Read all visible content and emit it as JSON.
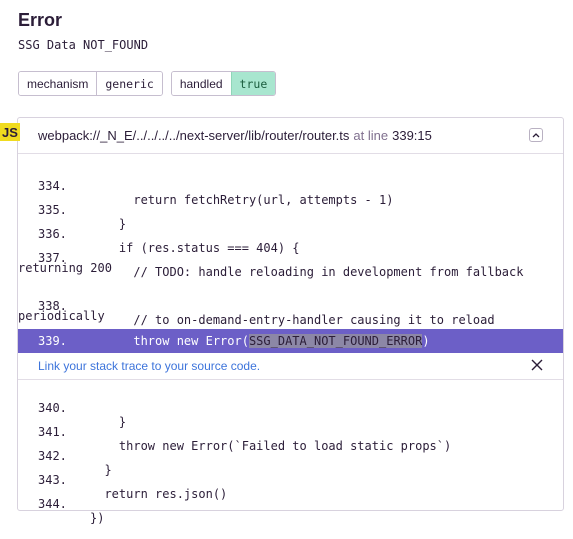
{
  "header": {
    "title": "Error",
    "subtitle": "SSG Data NOT_FOUND"
  },
  "tags": [
    {
      "key": "mechanism",
      "value": "generic"
    },
    {
      "key": "handled",
      "value": "true"
    }
  ],
  "frame": {
    "badge": "JS",
    "path": "webpack://_N_E/../../../../next-server/lib/router/router.ts",
    "at_text": "at line",
    "line_col": "339:15",
    "lines_before": [
      {
        "no": "334.",
        "code": "      return fetchRetry(url, attempts - 1)"
      },
      {
        "no": "335.",
        "code": "    }"
      },
      {
        "no": "336.",
        "code": "    if (res.status === 404) {"
      },
      {
        "no": "337.",
        "code": "      // TODO: handle reloading in development from fallback",
        "wrap": "returning 200"
      },
      {
        "no": "338.",
        "code": "      // to on-demand-entry-handler causing it to reload",
        "wrap": "periodically"
      }
    ],
    "highlight": {
      "no": "339.",
      "code_pre": "      throw new Error(",
      "code_token": "SSG_DATA_NOT_FOUND_ERROR",
      "code_post": ")"
    },
    "suggestion": "Link your stack trace to your source code.",
    "lines_after": [
      {
        "no": "340.",
        "code": "    }"
      },
      {
        "no": "341.",
        "code": "    throw new Error(`Failed to load static props`)"
      },
      {
        "no": "342.",
        "code": "  }"
      },
      {
        "no": "343.",
        "code": "  return res.json()"
      },
      {
        "no": "344.",
        "code": "})"
      }
    ]
  },
  "icons": {
    "collapse": "chevron-up-icon",
    "close": "close-icon"
  }
}
